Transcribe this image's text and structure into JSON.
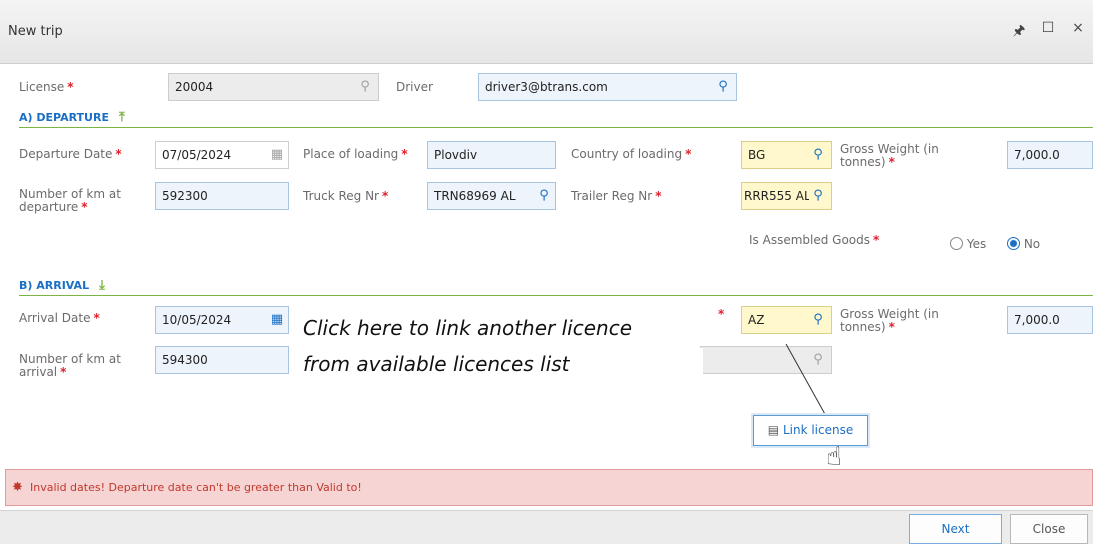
{
  "window": {
    "title": "New trip",
    "pin_glyph": "🖈",
    "maximize_glyph": "☐",
    "close_glyph": "×"
  },
  "license": {
    "label": "License",
    "value": "20004"
  },
  "driver": {
    "label": "Driver",
    "value": "driver3@btrans.com"
  },
  "departure": {
    "section_title": "A) DEPARTURE",
    "section_icon": "upload-arrow",
    "date_label": "Departure Date",
    "date_value": "07/05/2024",
    "place_label": "Place of loading",
    "place_value": "Plovdiv",
    "country_label": "Country of loading",
    "country_value": "BG",
    "gross_label": "Gross Weight (in tonnes)",
    "gross_value": "7,000.0",
    "km_label": "Number of km at departure",
    "km_value": "592300",
    "truck_label": "Truck Reg Nr",
    "truck_value": "TRN68969 AL",
    "trailer_label": "Trailer Reg Nr",
    "trailer_value": "RRR555 AL",
    "assembled_label": "Is Assembled Goods",
    "assembled_options": [
      "Yes",
      "No"
    ],
    "assembled_selected": "No"
  },
  "arrival": {
    "section_title": "B) ARRIVAL",
    "section_icon": "download-arrow",
    "date_label": "Arrival Date",
    "date_value": "10/05/2024",
    "country_value": "AZ",
    "gross_label": "Gross Weight (in tonnes)",
    "gross_value": "7,000.0",
    "km_label": "Number of km at arrival",
    "km_value": "594300",
    "link_button": "Link license"
  },
  "callout": {
    "line1": "Click here to link another licence",
    "line2": "from available licences list"
  },
  "error": {
    "message": "Invalid dates! Departure date can't be greater than Valid to!"
  },
  "footer": {
    "next_label": "Next",
    "close_label": "Close"
  },
  "colors": {
    "accent": "#1a6fc4",
    "section_line": "#7cb342",
    "required": "#e0202a",
    "error_bg": "#f7d4d4"
  }
}
